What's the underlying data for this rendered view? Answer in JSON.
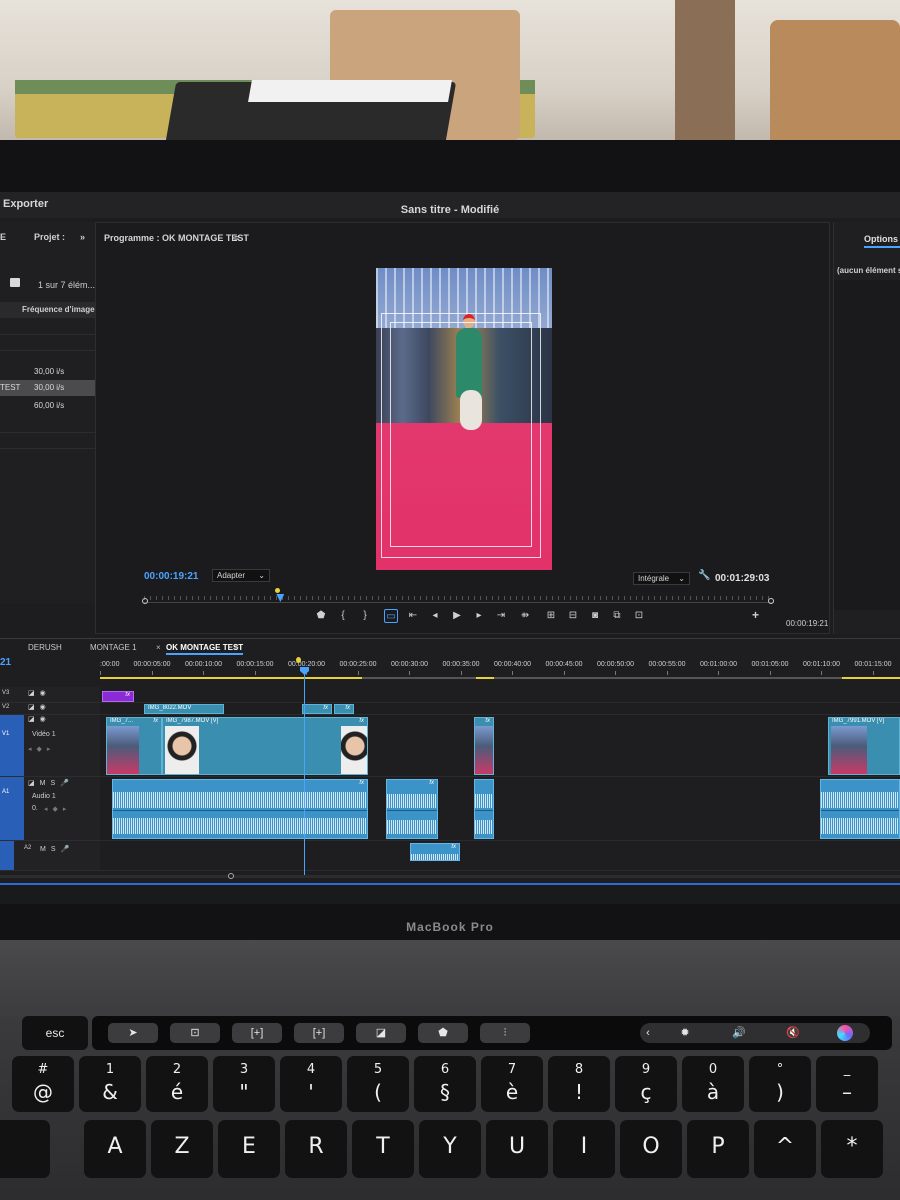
{
  "window": {
    "title": "Sans titre - Modifié",
    "export_label": "Exporter"
  },
  "project": {
    "tab_left": "E",
    "tab_label": "Projet :",
    "item_count": "1 sur 7 élém...",
    "column_header": "Fréquence d'image",
    "rows": [
      {
        "name": "",
        "fps": "30,00 i/s",
        "selected": false
      },
      {
        "name": "TEST",
        "fps": "30,00 i/s",
        "selected": true
      },
      {
        "name": "",
        "fps": "60,00 i/s",
        "selected": false
      }
    ]
  },
  "program": {
    "title": "Programme : OK MONTAGE TEST",
    "current_timecode": "00:00:19:21",
    "fit_option": "Adapter",
    "resolution_option": "Intégrale",
    "duration_timecode": "00:01:29:03",
    "playhead_progress": 0.21
  },
  "options_panel": {
    "tab_label": "Options d",
    "empty_text": "(aucun élément s",
    "timecode": "00:00:19:21"
  },
  "timeline": {
    "tabs": [
      "DERUSH",
      "MONTAGE 1",
      "OK MONTAGE TEST"
    ],
    "active_tab": "OK MONTAGE TEST",
    "timecode_fragment": "21",
    "ruler_labels": [
      ":00:00",
      "00:00:05:00",
      "00:00:10:00",
      "00:00:15:00",
      "00:00:20:00",
      "00:00:25:00",
      "00:00:30:00",
      "00:00:35:00",
      "00:00:40:00",
      "00:00:45:00",
      "00:00:50:00",
      "00:00:55:00",
      "00:01:00:00",
      "00:01:05:00",
      "00:01:10:00",
      "00:01:15:00"
    ],
    "tracks": {
      "v3": "V3",
      "v2": "V2",
      "v1": "V1",
      "v1_name": "Vidéo 1",
      "a1": "A1",
      "a1_name": "Audio 1",
      "a1_level": "0.",
      "a2": "A2"
    },
    "clips": {
      "v2_clip": "IMG_8022.MOV",
      "v1_clip_a": "IMG_7...",
      "v1_clip_b": "IMG_7987.MOV [V]",
      "v1_clip_c": "IMG_7991.MOV [V]",
      "fx": "fx"
    }
  },
  "laptop": {
    "brand": "MacBook Pro"
  },
  "keyboard": {
    "esc": "esc",
    "touchbar": [
      "➤",
      "⊡",
      "[+]",
      "[+]",
      "◪",
      "⬟",
      "⫶"
    ],
    "touchbar_right": [
      "‹",
      "✹",
      "🔊",
      "🔇"
    ],
    "number_row": [
      {
        "top": "#",
        "bottom": "@"
      },
      {
        "top": "1",
        "bottom": "&"
      },
      {
        "top": "2",
        "bottom": "é"
      },
      {
        "top": "3",
        "bottom": "\""
      },
      {
        "top": "4",
        "bottom": "'"
      },
      {
        "top": "5",
        "bottom": "("
      },
      {
        "top": "6",
        "bottom": "§"
      },
      {
        "top": "7",
        "bottom": "è"
      },
      {
        "top": "8",
        "bottom": "!"
      },
      {
        "top": "9",
        "bottom": "ç"
      },
      {
        "top": "0",
        "bottom": "à"
      },
      {
        "top": "°",
        "bottom": ")"
      },
      {
        "top": "_",
        "bottom": "–"
      }
    ],
    "letter_row": [
      "A",
      "Z",
      "E",
      "R",
      "T",
      "Y",
      "U",
      "I",
      "O",
      "P",
      "^",
      "*"
    ]
  }
}
